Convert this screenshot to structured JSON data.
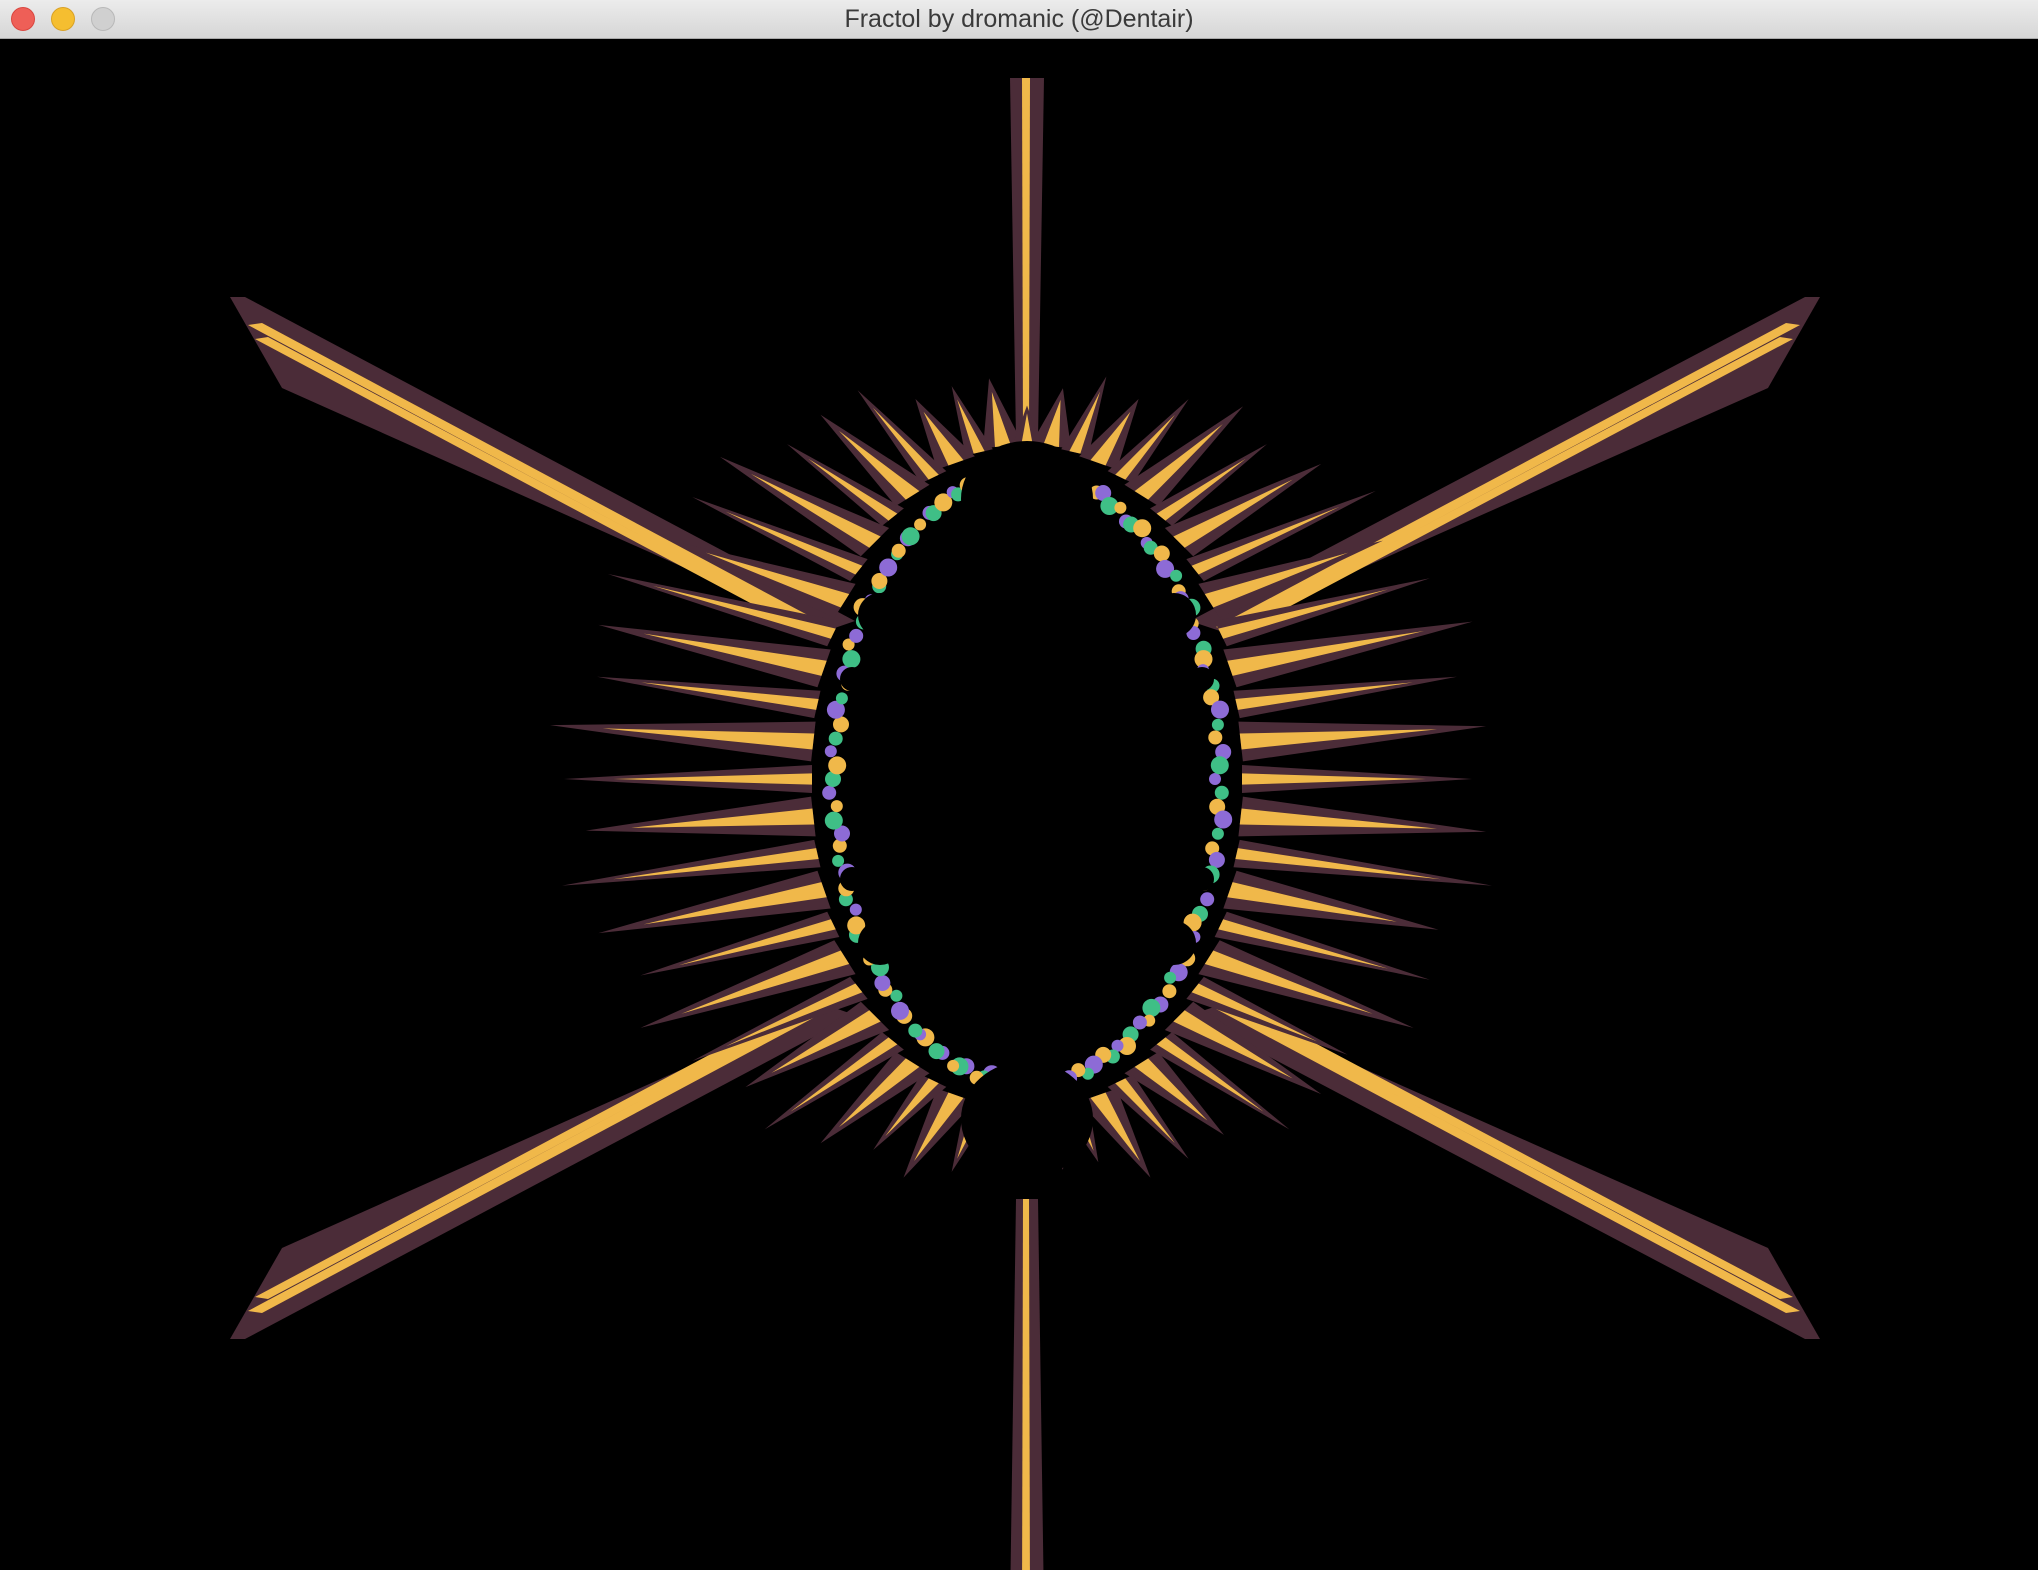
{
  "window": {
    "title": "Fractol by dromanic (@Dentair)",
    "buttons": {
      "close": "close-button",
      "minimize": "minimize-button",
      "zoom": "zoom-button"
    }
  },
  "render": {
    "background_color": "#000000",
    "palette": {
      "dark_band": "#4b2c38",
      "bright_band": "#f0b84a",
      "edge_green": "#3fbf86",
      "edge_violet": "#8d6bd6"
    }
  }
}
